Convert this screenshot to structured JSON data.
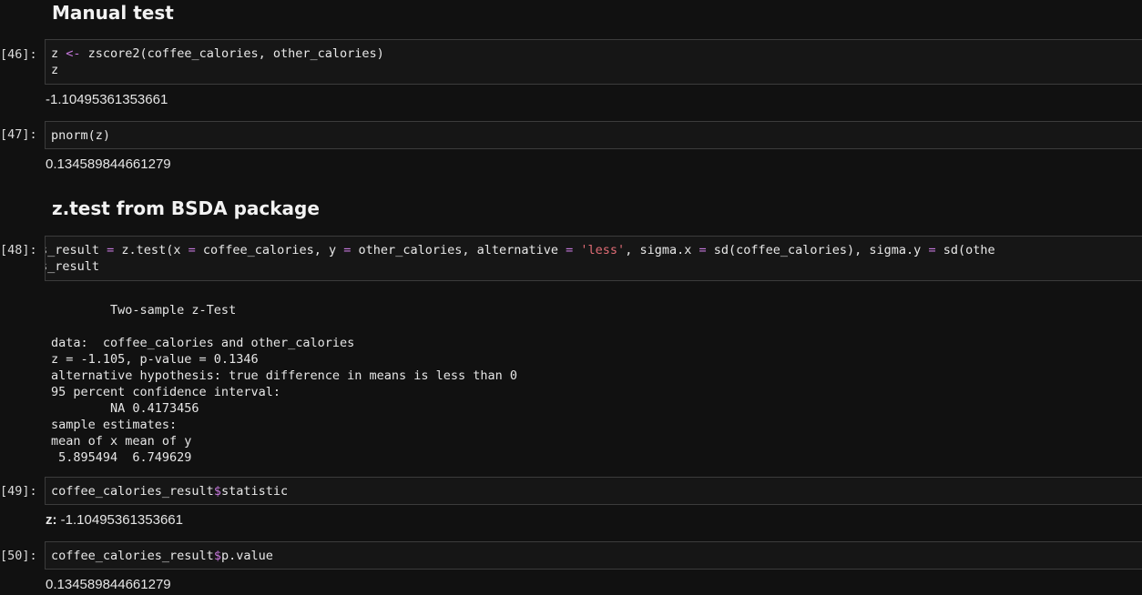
{
  "sections": {
    "manual_test": "Manual test",
    "ztest_bsda": "z.test from BSDA package"
  },
  "cells": {
    "c46": {
      "prompt": "[46]:",
      "line1": {
        "a": "z ",
        "op": "<-",
        "b": " zscore2(coffee_calories, other_calories)"
      },
      "line2": "z",
      "output": "-1.10495361353661"
    },
    "c47": {
      "prompt": "[47]:",
      "line1": "pnorm(z)",
      "output": "0.134589844661279"
    },
    "c48": {
      "prompt": "[48]:",
      "line1_parts": [
        "s_result ",
        "=",
        " z.test(x ",
        "=",
        " coffee_calories, y ",
        "=",
        " other_calories, alternative ",
        "=",
        " ",
        "'less'",
        ", sigma.x ",
        "=",
        " sd(coffee_calories), sigma.y ",
        "=",
        " sd(othe"
      ],
      "line2": "s_result",
      "output": {
        "title": "        Two-sample z-Test",
        "lines": [
          "data:  coffee_calories and other_calories",
          "z = -1.105, p-value = 0.1346",
          "alternative hypothesis: true difference in means is less than 0",
          "95 percent confidence interval:",
          "        NA 0.4173456",
          "sample estimates:",
          "mean of x mean of y",
          " 5.895494  6.749629"
        ]
      }
    },
    "c49": {
      "prompt": "[49]:",
      "code_a": "coffee_calories_result",
      "code_op": "$",
      "code_b": "statistic",
      "output_label": "z:",
      "output_value": " -1.10495361353661"
    },
    "c50": {
      "prompt": "[50]:",
      "code_a": "coffee_calories_result",
      "code_op": "$",
      "code_b": "p.value",
      "output": "0.134589844661279"
    }
  },
  "colors": {
    "background": "#111111",
    "operator": "#c678dd",
    "string": "#e06c75",
    "cell_border": "#3c3c3c"
  }
}
